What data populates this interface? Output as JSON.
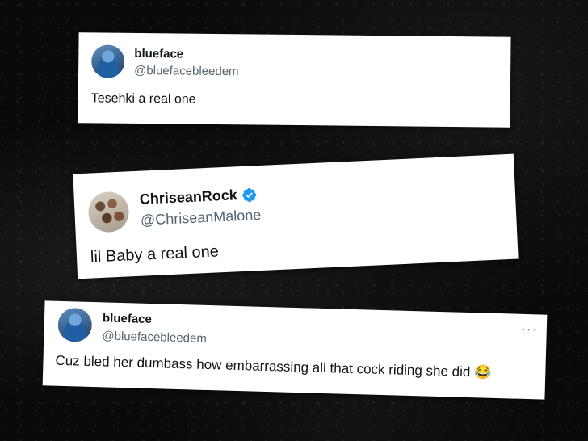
{
  "tweets": [
    {
      "name": "blueface",
      "handle": "@bluefacebleedem",
      "text": "Tesehki a real one",
      "avatar_icon": "profile-avatar-icon",
      "verified": false
    },
    {
      "name": "ChriseanRock",
      "handle": "@ChriseanMalone",
      "text": "lil Baby a real one",
      "avatar_icon": "profile-avatar-icon",
      "verified": true,
      "verified_icon": "verified-badge-icon",
      "verified_color": "#1d9bf0"
    },
    {
      "name": "blueface",
      "handle": "@bluefacebleedem",
      "text": "Cuz bled her dumbass how embarrassing all that cock riding she did",
      "emoji": "😂",
      "avatar_icon": "profile-avatar-icon",
      "more_icon": "more-options-icon",
      "more_label": "···",
      "verified": false
    }
  ]
}
